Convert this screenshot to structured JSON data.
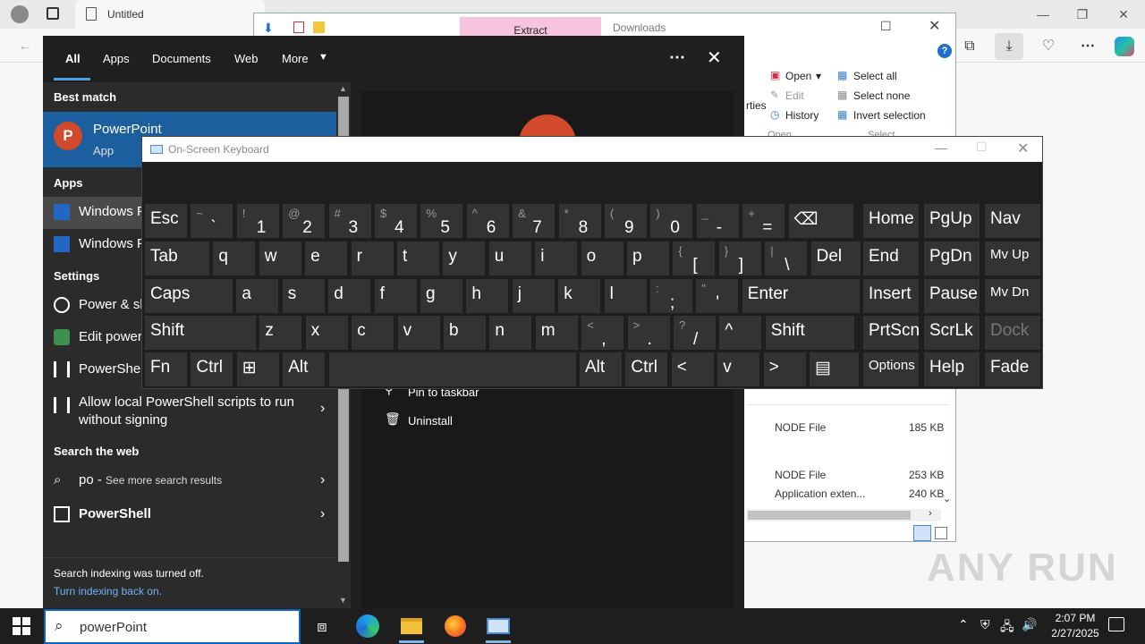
{
  "browser": {
    "tab_title": "Untitled",
    "window_controls": [
      "minimize",
      "restore",
      "close"
    ]
  },
  "explorer": {
    "extract_label": "Extract",
    "location": "Downloads",
    "ribbon": {
      "open": "Open",
      "edit": "Edit",
      "history": "History",
      "select_all": "Select all",
      "select_none": "Select none",
      "invert_selection": "Invert selection",
      "properties_fragment": "rties",
      "group_open": "Open",
      "group_select": "Select"
    },
    "files": [
      {
        "type": "NODE File",
        "size": "185 KB"
      },
      {
        "type": "NODE File",
        "size": "253 KB"
      },
      {
        "type": "Application exten...",
        "size": "240 KB"
      }
    ]
  },
  "start_menu": {
    "tabs": [
      "All",
      "Apps",
      "Documents",
      "Web",
      "More"
    ],
    "best_match_header": "Best match",
    "best_match": {
      "name": "PowerPoint",
      "type": "App"
    },
    "apps_header": "Apps",
    "apps": [
      "Windows PowerShell",
      "Windows PowerShell ISE"
    ],
    "settings_header": "Settings",
    "settings": [
      "Power & sleep settings",
      "Edit power plan",
      "PowerShell developer settings",
      "Allow local PowerShell scripts to run without signing"
    ],
    "web_header": "Search the web",
    "web_query": "po",
    "web_more": "See more search results",
    "web_result": "PowerShell",
    "footer_text": "Search indexing was turned off.",
    "footer_link": "Turn indexing back on.",
    "right_actions": [
      "Pin to taskbar",
      "Uninstall"
    ]
  },
  "osk": {
    "title": "On-Screen Keyboard",
    "rows": [
      [
        {
          "m": "Esc"
        },
        {
          "s": "~",
          "b": "`"
        },
        {
          "s": "!",
          "b": "1"
        },
        {
          "s": "@",
          "b": "2"
        },
        {
          "s": "#",
          "b": "3"
        },
        {
          "s": "$",
          "b": "4"
        },
        {
          "s": "%",
          "b": "5"
        },
        {
          "s": "^",
          "b": "6"
        },
        {
          "s": "&",
          "b": "7"
        },
        {
          "s": "*",
          "b": "8"
        },
        {
          "s": "(",
          "b": "9"
        },
        {
          "s": ")",
          "b": "0"
        },
        {
          "s": "_",
          "b": "-"
        },
        {
          "s": "+",
          "b": "="
        },
        {
          "m": "⌫"
        }
      ],
      [
        {
          "m": "Tab"
        },
        {
          "m": "q"
        },
        {
          "m": "w"
        },
        {
          "m": "e"
        },
        {
          "m": "r"
        },
        {
          "m": "t"
        },
        {
          "m": "y"
        },
        {
          "m": "u"
        },
        {
          "m": "i"
        },
        {
          "m": "o"
        },
        {
          "m": "p"
        },
        {
          "s": "{",
          "b": "["
        },
        {
          "s": "}",
          "b": "]"
        },
        {
          "s": "|",
          "b": "\\"
        },
        {
          "m": "Del"
        }
      ],
      [
        {
          "m": "Caps"
        },
        {
          "m": "a"
        },
        {
          "m": "s"
        },
        {
          "m": "d"
        },
        {
          "m": "f"
        },
        {
          "m": "g"
        },
        {
          "m": "h"
        },
        {
          "m": "j"
        },
        {
          "m": "k"
        },
        {
          "m": "l"
        },
        {
          "s": ":",
          "b": ";"
        },
        {
          "s": "\"",
          "b": "'"
        },
        {
          "m": "Enter"
        }
      ],
      [
        {
          "m": "Shift"
        },
        {
          "m": "z"
        },
        {
          "m": "x"
        },
        {
          "m": "c"
        },
        {
          "m": "v"
        },
        {
          "m": "b"
        },
        {
          "m": "n"
        },
        {
          "m": "m"
        },
        {
          "s": "<",
          "b": ","
        },
        {
          "s": ">",
          "b": "."
        },
        {
          "s": "?",
          "b": "/"
        },
        {
          "m": "^"
        },
        {
          "m": "Shift"
        }
      ],
      [
        {
          "m": "Fn"
        },
        {
          "m": "Ctrl"
        },
        {
          "m": "⊞"
        },
        {
          "m": "Alt"
        },
        {
          "m": ""
        },
        {
          "m": "Alt"
        },
        {
          "m": "Ctrl"
        },
        {
          "m": "<"
        },
        {
          "m": "v"
        },
        {
          "m": ">"
        },
        {
          "m": "▤"
        }
      ]
    ],
    "nav_rows": [
      [
        "Home",
        "PgUp",
        "Nav"
      ],
      [
        "End",
        "PgDn",
        "Mv Up"
      ],
      [
        "Insert",
        "Pause",
        "Mv Dn"
      ],
      [
        "PrtScn",
        "ScrLk",
        "Dock"
      ],
      [
        "Options",
        "Help",
        "Fade"
      ]
    ]
  },
  "taskbar": {
    "search_text": "powerPoint",
    "time": "2:07 PM",
    "date": "2/27/2025"
  },
  "watermark": "ANY RUN"
}
